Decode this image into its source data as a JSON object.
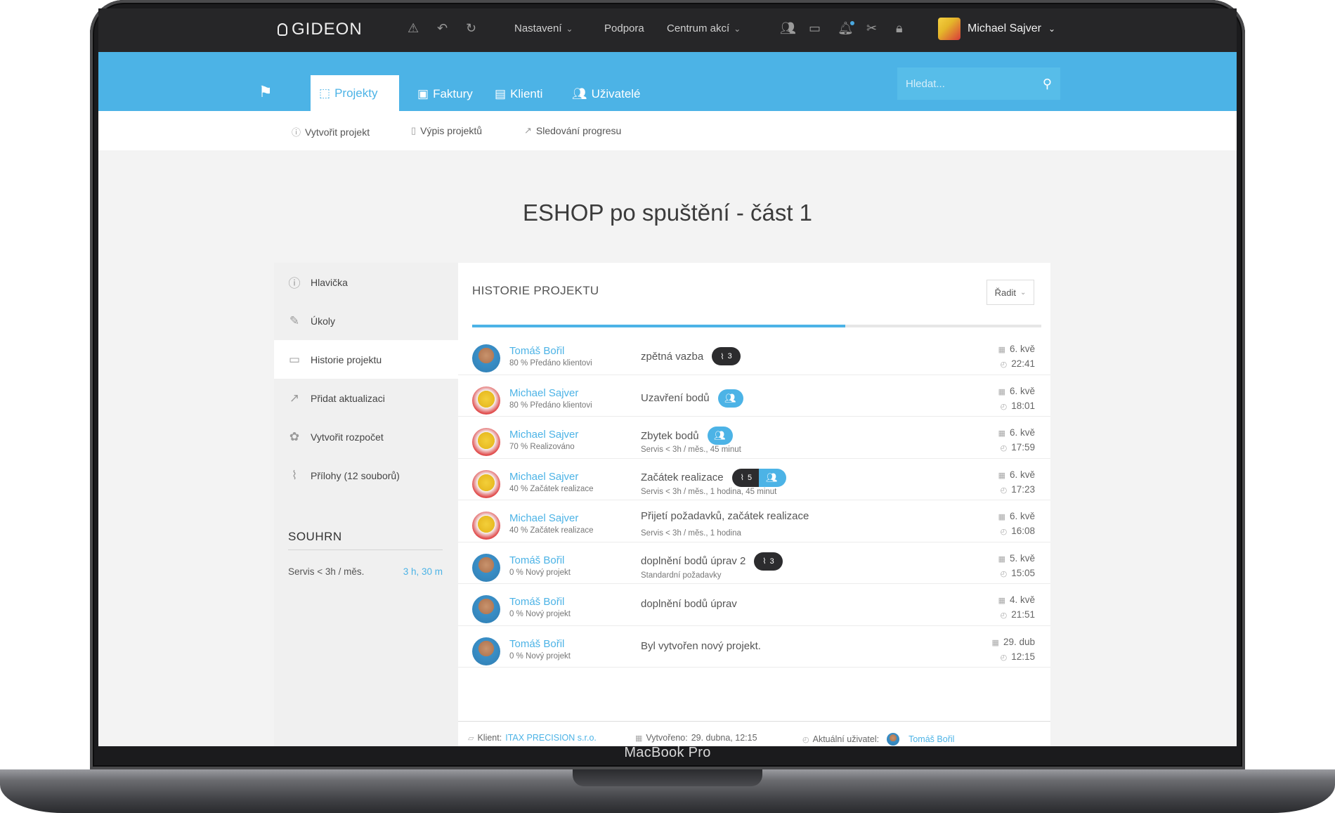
{
  "device": {
    "label": "MacBook Pro"
  },
  "topbar": {
    "logo": "GIDEON",
    "menu": [
      {
        "label": "Nastavení",
        "dropdown": true
      },
      {
        "label": "Podpora",
        "dropdown": false
      },
      {
        "label": "Centrum akcí",
        "dropdown": true
      }
    ],
    "user": {
      "name": "Michael Sajver"
    }
  },
  "nav": {
    "tabs": [
      {
        "label": "Projekty",
        "icon": "box-icon",
        "active": true
      },
      {
        "label": "Faktury",
        "icon": "invoice-icon",
        "active": false
      },
      {
        "label": "Klienti",
        "icon": "briefcase-icon",
        "active": false
      },
      {
        "label": "Uživatelé",
        "icon": "users-icon",
        "active": false
      }
    ],
    "search": {
      "placeholder": "Hledat..."
    }
  },
  "subnav": {
    "items": [
      {
        "label": "Vytvořit projekt"
      },
      {
        "label": "Výpis projektů"
      },
      {
        "label": "Sledování progresu"
      }
    ]
  },
  "page": {
    "title": "ESHOP po spuštění - část 1"
  },
  "sidebar": {
    "items": [
      {
        "label": "Hlavička",
        "icon": "info-icon",
        "active": false
      },
      {
        "label": "Úkoly",
        "icon": "edit-icon",
        "active": false
      },
      {
        "label": "Historie projektu",
        "icon": "comment-icon",
        "active": true
      },
      {
        "label": "Přidat aktualizaci",
        "icon": "chart-line-icon",
        "active": false
      },
      {
        "label": "Vytvořit rozpočet",
        "icon": "piggy-bank-icon",
        "active": false
      },
      {
        "label": "Přílohy (12 souborů)",
        "icon": "paperclip-icon",
        "active": false
      }
    ],
    "summary": {
      "title": "SOUHRN",
      "rows": [
        {
          "label": "Servis < 3h / měs.",
          "value": "3 h, 30 m"
        }
      ]
    }
  },
  "history": {
    "title": "HISTORIE PROJEKTU",
    "sort_label": "Řadit",
    "progress": 0.655,
    "entries": [
      {
        "user": "Tomáš Bořil",
        "avatar": "tomas",
        "status": "80 % Předáno klientovi",
        "action": "zpětná vazba",
        "detail": "",
        "attachments": "3",
        "users_badge": false,
        "date": "6. kvě",
        "time": "22:41"
      },
      {
        "user": "Michael Sajver",
        "avatar": "michael",
        "status": "80 % Předáno klientovi",
        "action": "Uzavření bodů",
        "detail": "",
        "attachments": "",
        "users_badge": true,
        "date": "6. kvě",
        "time": "18:01"
      },
      {
        "user": "Michael Sajver",
        "avatar": "michael",
        "status": "70 % Realizováno",
        "action": "Zbytek bodů",
        "detail": "Servis < 3h / měs., 45 minut",
        "attachments": "",
        "users_badge": true,
        "date": "6. kvě",
        "time": "17:59"
      },
      {
        "user": "Michael Sajver",
        "avatar": "michael",
        "status": "40 % Začátek realizace",
        "action": "Začátek realizace",
        "detail": "Servis < 3h / měs., 1 hodina, 45 minut",
        "attachments": "5",
        "users_badge": true,
        "date": "6. kvě",
        "time": "17:23"
      },
      {
        "user": "Michael Sajver",
        "avatar": "michael",
        "status": "40 % Začátek realizace",
        "action": "Přijetí požadavků, začátek realizace",
        "detail": "Servis < 3h / měs., 1 hodina",
        "attachments": "",
        "users_badge": false,
        "date": "6. kvě",
        "time": "16:08"
      },
      {
        "user": "Tomáš Bořil",
        "avatar": "tomas",
        "status": "0 % Nový projekt",
        "action": "doplnění bodů úprav 2",
        "detail": "Standardní požadavky",
        "attachments": "3",
        "users_badge": false,
        "date": "5. kvě",
        "time": "15:05"
      },
      {
        "user": "Tomáš Bořil",
        "avatar": "tomas",
        "status": "0 % Nový projekt",
        "action": "doplnění bodů úprav",
        "detail": "",
        "attachments": "",
        "users_badge": false,
        "date": "4. kvě",
        "time": "21:51"
      },
      {
        "user": "Tomáš Bořil",
        "avatar": "tomas",
        "status": "0 % Nový projekt",
        "action": "Byl vytvořen nový projekt.",
        "detail": "",
        "attachments": "",
        "users_badge": false,
        "date": "29. dub",
        "time": "12:15"
      }
    ],
    "footer": {
      "client_label": "Klient:",
      "client_value": "ITAX PRECISION s.r.o.",
      "created_label": "Vytvořeno:",
      "created_value": "29. dubna, 12:15",
      "current_user_label": "Aktuální uživatel:",
      "current_user_value": "Tomáš Bořil"
    }
  },
  "colors": {
    "accent": "#4cb3e6",
    "topbar": "#262628",
    "dark_badge": "#2c2c2e"
  }
}
